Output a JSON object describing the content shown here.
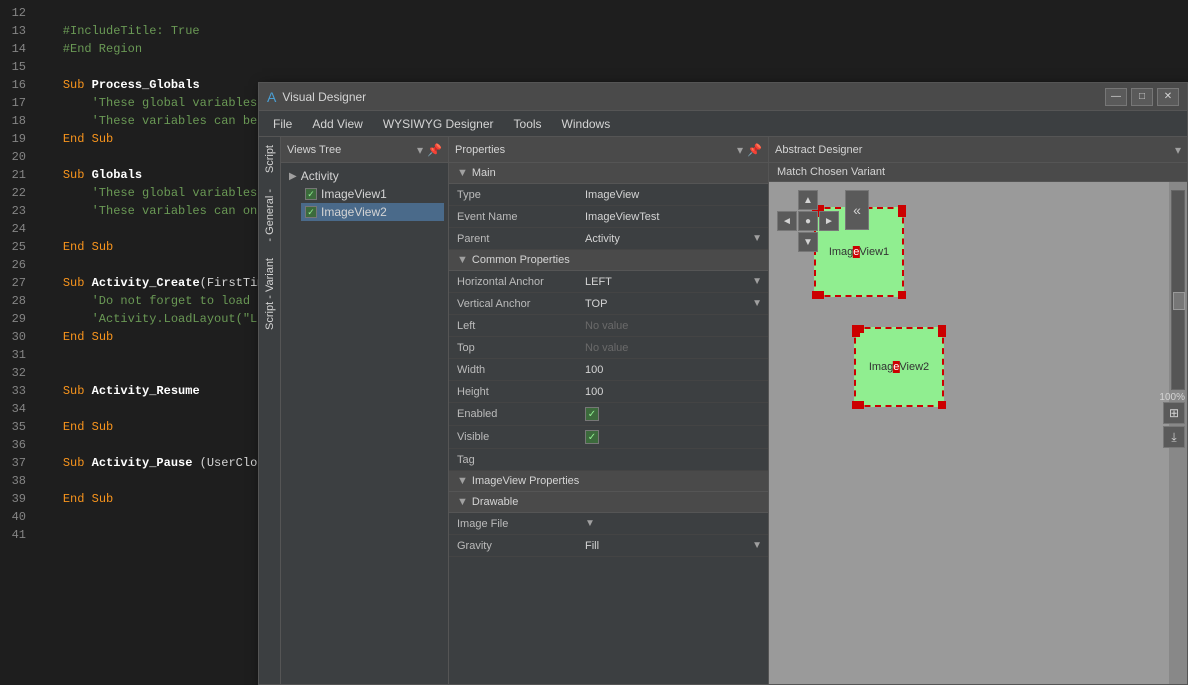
{
  "app_title": "Visual Designer",
  "editor": {
    "lines": [
      {
        "num": "12",
        "content": "",
        "parts": []
      },
      {
        "num": "13",
        "content": "\t#IncludeTitle: True",
        "type": "comment"
      },
      {
        "num": "14",
        "content": "\t#End Region",
        "type": "comment"
      },
      {
        "num": "15",
        "content": "",
        "parts": []
      },
      {
        "num": "16",
        "content": "\tSub Process_Globals",
        "type": "sub"
      },
      {
        "num": "17",
        "content": "\t\t'These global variables will be declared once when the application starts.",
        "type": "comment"
      },
      {
        "num": "18",
        "content": "\t\t'These variables can be acc",
        "type": "comment"
      },
      {
        "num": "19",
        "content": "\tEnd Sub",
        "type": "end_sub"
      },
      {
        "num": "20",
        "content": "",
        "parts": []
      },
      {
        "num": "21",
        "content": "\tSub Globals",
        "type": "sub"
      },
      {
        "num": "22",
        "content": "\t\t'These global variables will...",
        "type": "comment"
      },
      {
        "num": "23",
        "content": "\t\t'These variables can only b...",
        "type": "comment"
      },
      {
        "num": "24",
        "content": "",
        "parts": []
      },
      {
        "num": "25",
        "content": "\tEnd Sub",
        "type": "end_sub"
      },
      {
        "num": "26",
        "content": "",
        "parts": []
      },
      {
        "num": "27",
        "content": "\tSub Activity_Create(FirstTime A",
        "type": "sub"
      },
      {
        "num": "28",
        "content": "\t\t'Do not forget to load the",
        "type": "comment"
      },
      {
        "num": "29",
        "content": "\t\t'Activity.LoadLayout(\"Layou",
        "type": "comment"
      },
      {
        "num": "30",
        "content": "\tEnd Sub",
        "type": "end_sub"
      },
      {
        "num": "31",
        "content": "",
        "parts": []
      },
      {
        "num": "32",
        "content": "",
        "parts": []
      },
      {
        "num": "33",
        "content": "\tSub Activity_Resume",
        "type": "sub"
      },
      {
        "num": "34",
        "content": "",
        "parts": []
      },
      {
        "num": "35",
        "content": "\tEnd Sub",
        "type": "end_sub"
      },
      {
        "num": "36",
        "content": "",
        "parts": []
      },
      {
        "num": "37",
        "content": "\tSub Activity_Pause (UserClosed",
        "type": "sub"
      },
      {
        "num": "38",
        "content": "",
        "parts": []
      },
      {
        "num": "39",
        "content": "\tEnd Sub",
        "type": "end_sub"
      },
      {
        "num": "40",
        "content": "",
        "parts": []
      },
      {
        "num": "41",
        "content": "",
        "parts": []
      }
    ]
  },
  "menubar": {
    "items": [
      "File",
      "Add View",
      "WYSIWYG Designer",
      "Tools",
      "Windows"
    ]
  },
  "views_tree": {
    "panel_title": "Views Tree",
    "root": {
      "label": "Activity",
      "children": [
        {
          "label": "ImageView1",
          "checked": true
        },
        {
          "label": "ImageView2",
          "checked": true
        }
      ]
    }
  },
  "properties": {
    "panel_title": "Properties",
    "sections": {
      "main": {
        "title": "Main",
        "rows": [
          {
            "name": "Type",
            "value": "ImageView",
            "has_dropdown": false
          },
          {
            "name": "Event Name",
            "value": "ImageViewTest",
            "has_dropdown": false
          },
          {
            "name": "Parent",
            "value": "Activity",
            "has_dropdown": true
          }
        ]
      },
      "common": {
        "title": "Common Properties",
        "rows": [
          {
            "name": "Horizontal Anchor",
            "value": "LEFT",
            "has_dropdown": true
          },
          {
            "name": "Vertical Anchor",
            "value": "TOP",
            "has_dropdown": true
          },
          {
            "name": "Left",
            "value": "No value",
            "has_dropdown": false,
            "empty": true
          },
          {
            "name": "Top",
            "value": "No value",
            "has_dropdown": false,
            "empty": true
          },
          {
            "name": "Width",
            "value": "100",
            "has_dropdown": false
          },
          {
            "name": "Height",
            "value": "100",
            "has_dropdown": false
          },
          {
            "name": "Enabled",
            "value": "",
            "has_checkbox": true
          },
          {
            "name": "Visible",
            "value": "",
            "has_checkbox": true
          },
          {
            "name": "Tag",
            "value": "",
            "has_dropdown": false
          }
        ]
      },
      "imageview": {
        "title": "ImageView Properties",
        "rows": []
      },
      "drawable": {
        "title": "Drawable",
        "rows": [
          {
            "name": "Image File",
            "value": "",
            "has_dropdown": true
          },
          {
            "name": "Gravity",
            "value": "Fill",
            "has_dropdown": true
          }
        ]
      }
    }
  },
  "abstract_designer": {
    "panel_title": "Abstract Designer",
    "match_label": "Match Chosen Variant",
    "zoom_pct": "100%",
    "imageview1_label": "ImageView1",
    "imageview2_label": "ImageView2"
  },
  "window": {
    "title": "Visual Designer",
    "controls": {
      "minimize": "—",
      "maximize": "□",
      "close": "✕"
    }
  }
}
